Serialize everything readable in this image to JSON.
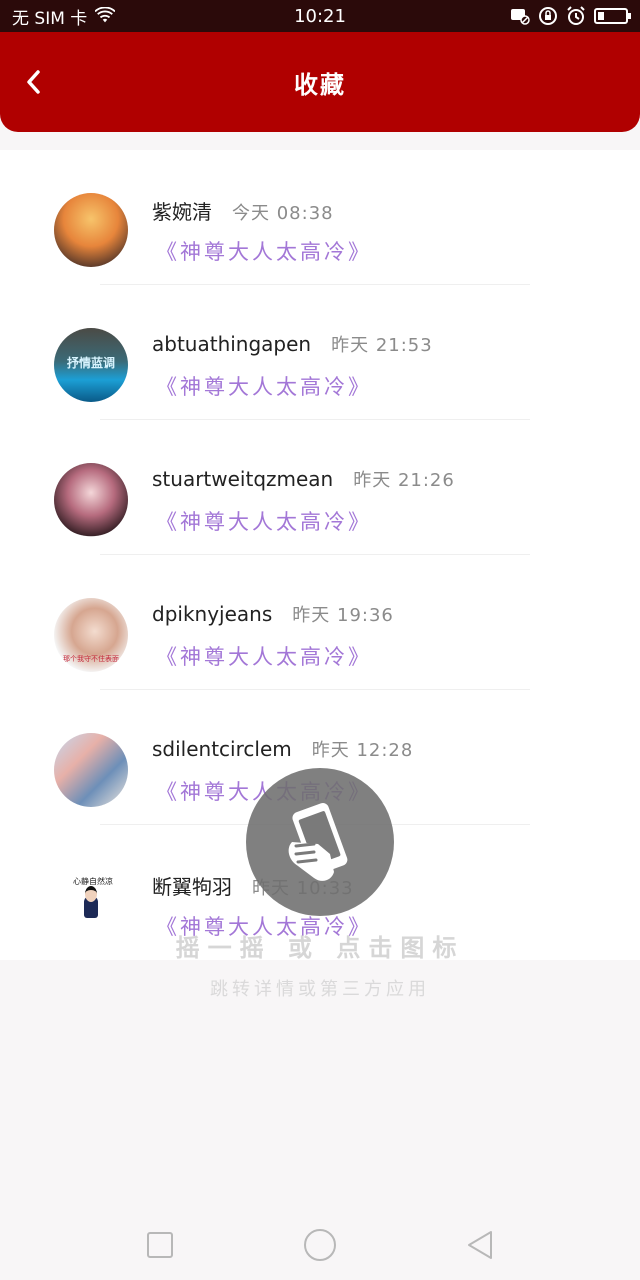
{
  "status_bar": {
    "carrier": "无 SIM 卡",
    "time": "10:21",
    "wifi_icon": "wifi-icon",
    "battery_icon": "battery-icon"
  },
  "header": {
    "title": "收藏",
    "back_icon": "chevron-left-icon",
    "color": "#b00000"
  },
  "items": [
    {
      "username": "紫婉清",
      "time": "今天 08:38",
      "book": "《神尊大人太高冷》"
    },
    {
      "username": "abtuathingapen",
      "time": "昨天 21:53",
      "book": "《神尊大人太高冷》",
      "avatar_text": "抒情蓝调"
    },
    {
      "username": "stuartweitqzmean",
      "time": "昨天 21:26",
      "book": "《神尊大人太高冷》"
    },
    {
      "username": "dpiknyjeans",
      "time": "昨天 19:36",
      "book": "《神尊大人太高冷》",
      "avatar_text": "那个我守不住表面"
    },
    {
      "username": "sdilentcirclem",
      "time": "昨天 12:28",
      "book": "《神尊大人太高冷》"
    },
    {
      "username": "断翼𤘽羽",
      "time": "昨天 10:33",
      "book": "《神尊大人太高冷》",
      "avatar_text": "心静自然凉"
    }
  ],
  "overlay": {
    "icon": "phone-shake-icon",
    "hint_primary": "摇一摇 或 点击图标",
    "hint_secondary": "跳转详情或第三方应用"
  },
  "nav": {
    "recent_icon": "square-icon",
    "home_icon": "circle-icon",
    "back_icon": "triangle-back-icon"
  },
  "colors": {
    "accent": "#b00000",
    "book_title": "#a377d7"
  }
}
